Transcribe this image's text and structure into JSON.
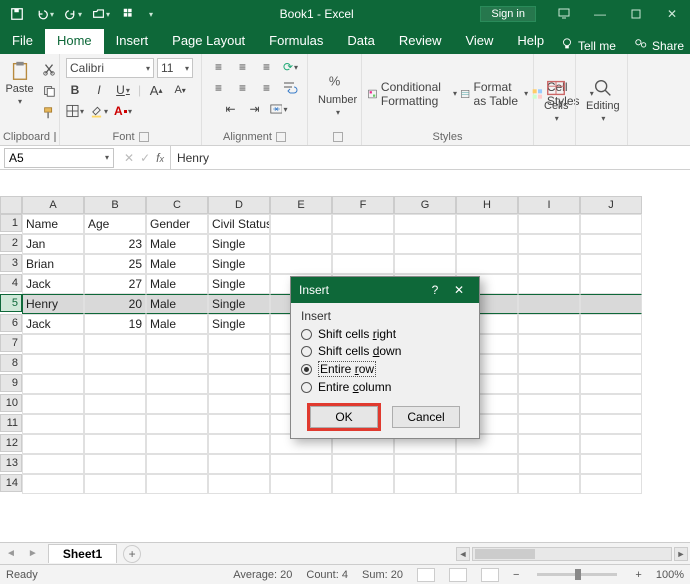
{
  "window": {
    "title": "Book1 - Excel",
    "signin": "Sign in"
  },
  "tabs": {
    "file": "File",
    "home": "Home",
    "insert": "Insert",
    "pagelayout": "Page Layout",
    "formulas": "Formulas",
    "data": "Data",
    "review": "Review",
    "view": "View",
    "help": "Help",
    "tellme": "Tell me",
    "share": "Share"
  },
  "ribbon": {
    "clipboard": {
      "label": "Clipboard",
      "paste": "Paste"
    },
    "font": {
      "label": "Font",
      "name": "Calibri",
      "size": "11"
    },
    "alignment": {
      "label": "Alignment"
    },
    "number": {
      "label": "Number",
      "btn": "Number"
    },
    "styles": {
      "label": "Styles",
      "cond": "Conditional Formatting",
      "table": "Format as Table",
      "cell": "Cell Styles"
    },
    "cells": {
      "label": "Cells",
      "btn": "Cells"
    },
    "editing": {
      "label": "Editing",
      "btn": "Editing"
    }
  },
  "formula_bar": {
    "ref": "A5",
    "value": "Henry"
  },
  "columns": [
    "A",
    "B",
    "C",
    "D",
    "E",
    "F",
    "G",
    "H",
    "I",
    "J"
  ],
  "sheet": {
    "headers": [
      "Name",
      "Age",
      "Gender",
      "Civil Status"
    ],
    "rows": [
      {
        "name": "Jan",
        "age": 23,
        "gender": "Male",
        "status": "Single"
      },
      {
        "name": "Brian",
        "age": 25,
        "gender": "Male",
        "status": "Single"
      },
      {
        "name": "Jack",
        "age": 27,
        "gender": "Male",
        "status": "Single"
      },
      {
        "name": "Henry",
        "age": 20,
        "gender": "Male",
        "status": "Single"
      },
      {
        "name": "Jack",
        "age": 19,
        "gender": "Male",
        "status": "Single"
      }
    ],
    "selected_row_index": 3,
    "tab": "Sheet1"
  },
  "dialog": {
    "title": "Insert",
    "group_label": "Insert",
    "options": {
      "right": {
        "pre": "Shift cells ",
        "accel": "r",
        "post": "ight"
      },
      "down": {
        "pre": "Shift cells ",
        "accel": "d",
        "post": "own"
      },
      "row": {
        "pre": "Entire ",
        "accel": "r",
        "post": "ow"
      },
      "column": {
        "pre": "Entire ",
        "accel": "c",
        "post": "olumn"
      }
    },
    "selected": "row",
    "ok": "OK",
    "cancel": "Cancel"
  },
  "status": {
    "state": "Ready",
    "average_label": "Average:",
    "average": "20",
    "count_label": "Count:",
    "count": "4",
    "sum_label": "Sum:",
    "sum": "20",
    "zoom": "100%"
  }
}
